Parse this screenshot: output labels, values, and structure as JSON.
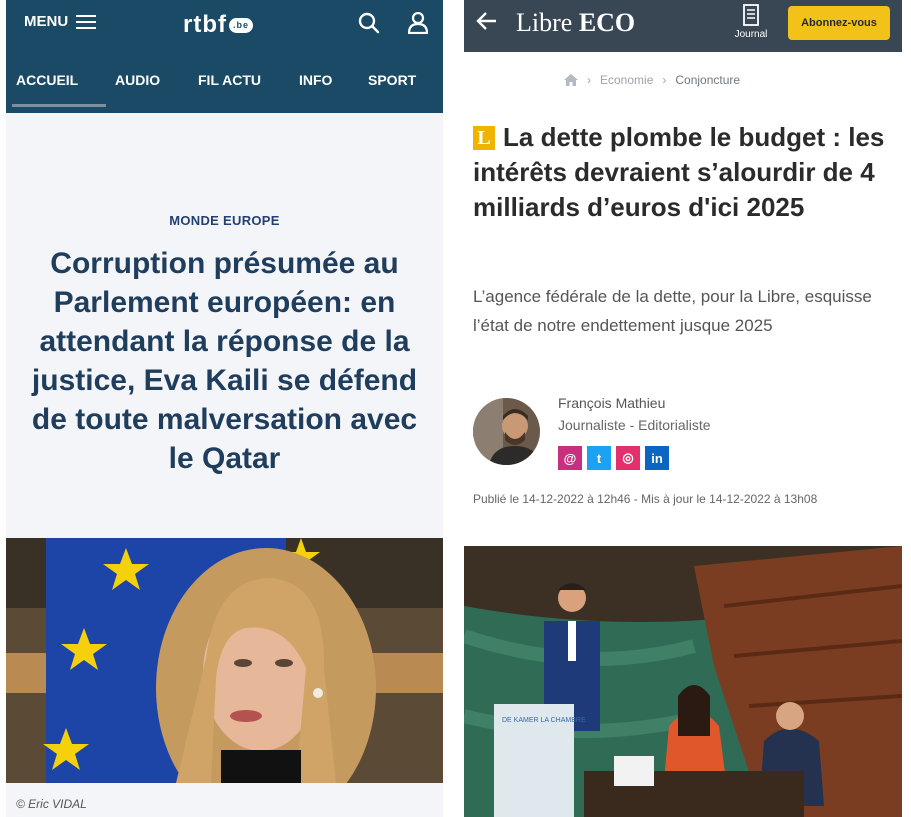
{
  "rtbf": {
    "menu_label": "MENU",
    "logo_text": "rtbf",
    "logo_suffix": ".be",
    "nav": [
      "ACCUEIL",
      "AUDIO",
      "FIL ACTU",
      "INFO",
      "SPORT"
    ],
    "kicker": "MONDE EUROPE",
    "headline": "Corruption présumée au Parlement européen: en attendant la réponse de la justice, Eva Kaili se défend de toute malversation avec le Qatar",
    "photo_credit": "© Eric VIDAL"
  },
  "libre": {
    "logo_part1": "Libre",
    "logo_part2": "ECO",
    "journal_label": "Journal",
    "subscribe_label": "Abonnez-vous",
    "breadcrumb": [
      "Economie",
      "Conjoncture"
    ],
    "badge": "L",
    "headline": "La dette plombe le budget : les intérêts devraient s’alourdir de 4 milliards d’euros d'ici 2025",
    "lead": "L’agence fédérale de la dette, pour la Libre, esquisse l’état de notre endettement jusque 2025",
    "author_name": "François Mathieu",
    "author_role": "Journaliste - Editorialiste",
    "social": [
      "@",
      "t",
      "◎",
      "in"
    ],
    "date_line": "Publié le 14-12-2022 à 12h46 - Mis à jour le 14-12-2022 à 13h08",
    "podium_text": "DE KAMER LA CHAMBRE"
  },
  "colors": {
    "rtbf_header": "#1b4a66",
    "rtbf_title": "#1f3d5c",
    "libre_header": "#394654",
    "libre_accent": "#f3c21a"
  }
}
